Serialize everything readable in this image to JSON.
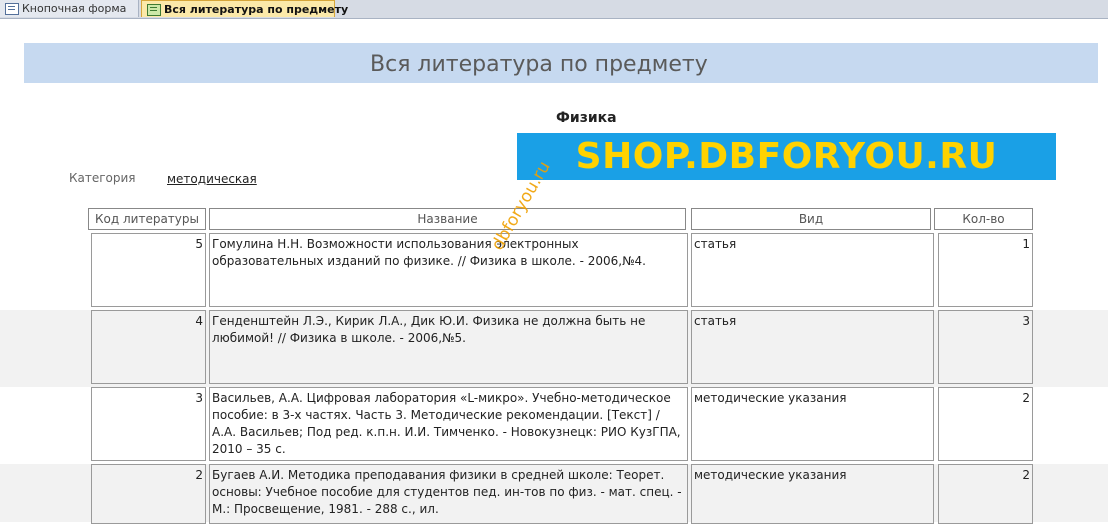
{
  "tabs": [
    {
      "label": "Кнопочная форма"
    },
    {
      "label": "Вся литература по предмету"
    }
  ],
  "report": {
    "title": "Вся литература по предмету",
    "subject": "Физика",
    "banner": "SHOP.DBFORYOU.RU",
    "category_label": "Категория",
    "category_value": "методическая",
    "watermark": "dbforyou.ru"
  },
  "columns": {
    "code": "Код литературы",
    "name": "Название",
    "kind": "Вид",
    "qty": "Кол-во"
  },
  "rows": [
    {
      "code": "5",
      "name": "Гомулина Н.Н. Возможности использования электронных образовательных изданий по физике. // Физика в школе. - 2006,№4.",
      "kind": "статья",
      "qty": "1"
    },
    {
      "code": "4",
      "name": "Генденштейн Л.Э., Кирик Л.А., Дик Ю.И. Физика не должна быть не любимой! // Физика в школе. - 2006,№5.",
      "kind": "статья",
      "qty": "3"
    },
    {
      "code": "3",
      "name": " Васильев, А.А. Цифровая лаборатория «L-микро». Учебно-методическое пособие: в 3-х частях. Часть 3. Методические рекомендации. [Текст] / А.А.  Васильев; Под ред. к.п.н. И.И. Тимченко. - Новокузнецк: РИО КузГПА, 2010 – 35 с.",
      "kind": "методические указания",
      "qty": "2"
    },
    {
      "code": "2",
      "name": "Бугаев А.И. Методика преподавания физики в средней школе: Теорет. основы: Учебное пособие для студентов пед. ин-тов по физ. - мат. спец. - М.: Просвещение, 1981. - 288 с., ил.",
      "kind": "методические указания",
      "qty": "2"
    }
  ]
}
